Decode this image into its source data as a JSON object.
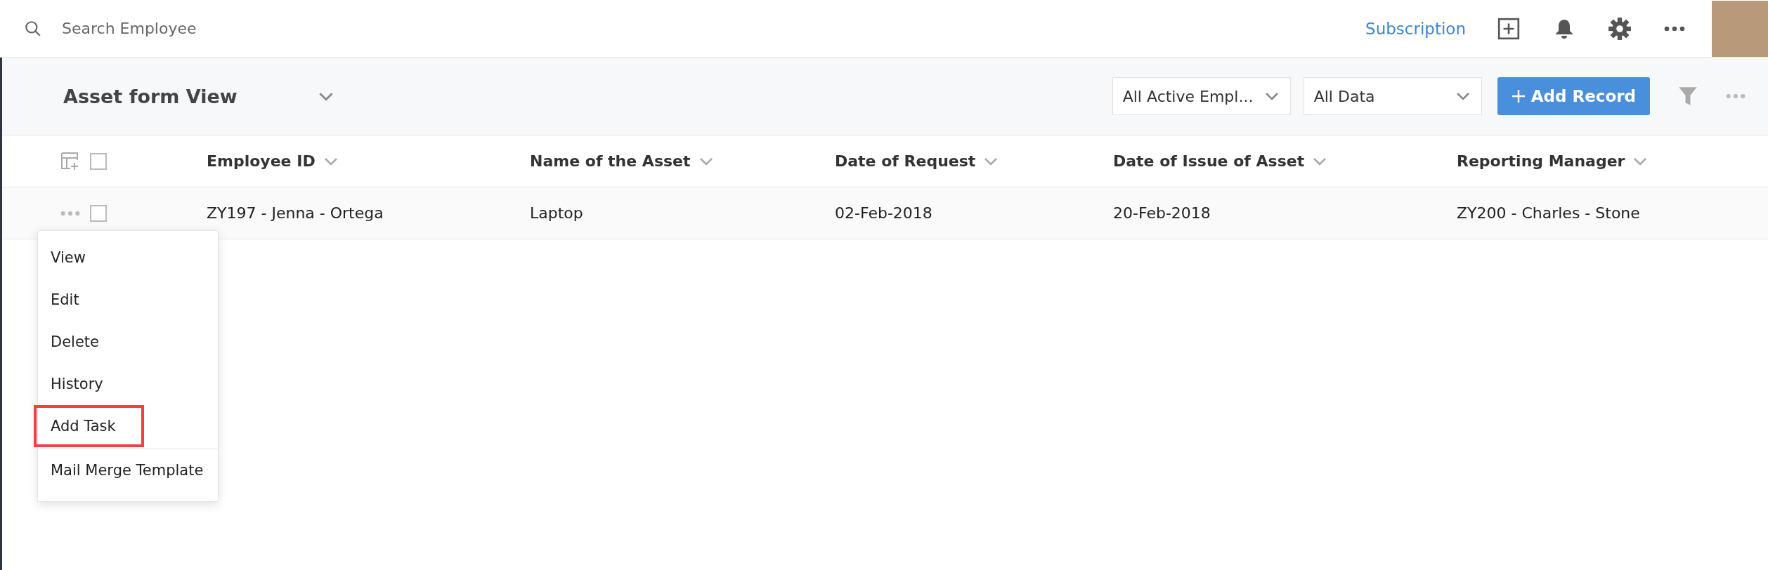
{
  "top_bar": {
    "search": {
      "placeholder": "Search Employee"
    },
    "subscription_link": "Subscription"
  },
  "toolbar": {
    "view_title": "Asset form View",
    "filters": [
      {
        "value": "All Active Empl..."
      },
      {
        "value": "All Data"
      }
    ],
    "add_button": "Add Record"
  },
  "table": {
    "select_all_checked": false,
    "columns": [
      "Employee ID",
      "Name of the Asset",
      "Date of Request",
      "Date of Issue of Asset",
      "Reporting Manager"
    ],
    "rows": [
      {
        "checked": false,
        "cells": [
          "ZY197 - Jenna - Ortega",
          "Laptop",
          "02-Feb-2018",
          "20-Feb-2018",
          "ZY200 - Charles - Stone"
        ]
      }
    ]
  },
  "row_menu": {
    "sections": [
      [
        {
          "label": "View",
          "highlighted": false
        },
        {
          "label": "Edit",
          "highlighted": false
        },
        {
          "label": "Delete",
          "highlighted": false
        },
        {
          "label": "History",
          "highlighted": false
        },
        {
          "label": "Add Task",
          "highlighted": true
        }
      ],
      [
        {
          "label": "Mail Merge Template",
          "highlighted": false
        }
      ]
    ]
  }
}
